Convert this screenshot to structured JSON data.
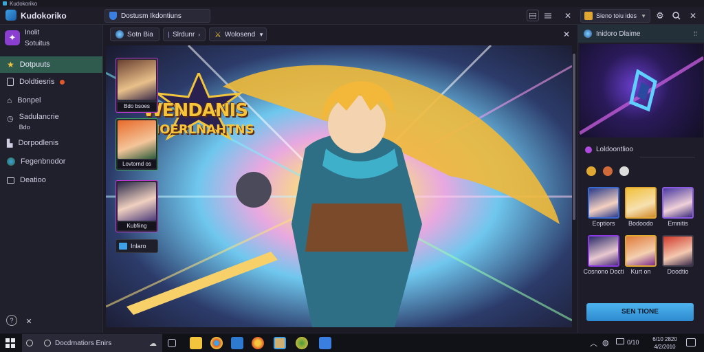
{
  "window": {
    "title": "Kudokoriko"
  },
  "appbar": {
    "app_name": "Kudokoriko",
    "tab_title": "Dostusm Ikdontiuns",
    "account_label": "Sieno toiu ides"
  },
  "sidebar": {
    "header_line1": "Inolit",
    "header_line2": "Sotuitus",
    "items": [
      {
        "label": "Dotpuuts"
      },
      {
        "label": "Doldtiesris"
      },
      {
        "label": "Bonpel"
      },
      {
        "label": "Sadulancrie",
        "sub": "Bdo"
      },
      {
        "label": "Dorpodlenis"
      },
      {
        "label": "Fegenbnodor"
      },
      {
        "label": "Deatioo"
      }
    ]
  },
  "toolbar": {
    "tabs": [
      {
        "label": "Sotn Bia"
      },
      {
        "label": "Slrdunr"
      },
      {
        "label": "Wolosend"
      }
    ]
  },
  "artwork": {
    "title_line1": "WENDANIS",
    "title_line2": "PHOERLNAHTNS"
  },
  "thumbnails": [
    {
      "label": "Bdo bsoes"
    },
    {
      "label": "Lovtornd os"
    },
    {
      "label": "Kubfiing"
    },
    {
      "label": "Inlaro"
    }
  ],
  "right_panel": {
    "header": "Inidoro Dlaime",
    "section_title": "Loldoontlioo",
    "characters": [
      {
        "name": "Eoptiors"
      },
      {
        "name": "Bodoodo"
      },
      {
        "name": "Emnitis"
      },
      {
        "name": "Cosnono Docti"
      },
      {
        "name": "Kurt on"
      },
      {
        "name": "Doodtio"
      }
    ],
    "action_button": "SEN TIONE"
  },
  "taskbar": {
    "search_placeholder": "Docdrnatiors Enirs",
    "time": "6/10 2820",
    "date": "4/2/2010",
    "tray_text": "0/10"
  },
  "colors": {
    "accent_green": "#2f5a4e",
    "accent_blue": "#3ea0e6",
    "gold": "#f2c53d"
  }
}
